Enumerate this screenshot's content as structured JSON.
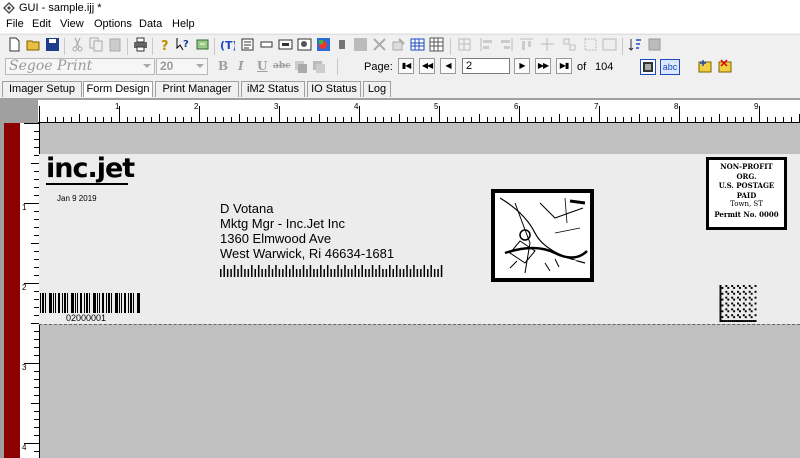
{
  "window": {
    "title": "GUI - sample.ijj *"
  },
  "menu": [
    "File",
    "Edit",
    "View",
    "Options",
    "Data",
    "Help"
  ],
  "format_bar": {
    "font_name": "Segoe Print",
    "font_size": "20",
    "bold_label": "B",
    "italic_label": "I",
    "underline_label": "U",
    "strike_label": "abc"
  },
  "pager": {
    "label": "Page:",
    "current": "2",
    "of_label": "of",
    "total": "104",
    "text_toggle_label": "abc"
  },
  "tabs": [
    {
      "label": "Imager Setup",
      "active": false
    },
    {
      "label": "Form Design",
      "active": true
    },
    {
      "label": "Print Manager",
      "active": false
    },
    {
      "label": "iM2 Status",
      "active": false
    },
    {
      "label": "IO Status",
      "active": false
    },
    {
      "label": "Log",
      "active": false
    }
  ],
  "ruler": {
    "horizontal": [
      "1",
      "2",
      "3",
      "4",
      "5",
      "6",
      "7",
      "8",
      "9"
    ],
    "vertical": [
      "1",
      "2",
      "3",
      "4"
    ]
  },
  "label": {
    "logo": "inc.jet",
    "date": "Jan 9 2019",
    "address": [
      "D Votana",
      "Mktg Mgr - Inc.Jet Inc",
      "1360 Elmwood Ave",
      "West Warwick, Ri 46634-1681"
    ],
    "stamp": [
      "NON-PROFIT",
      "ORG.",
      "U.S. POSTAGE",
      "PAID",
      "Town, ST",
      "Permit No. 0000"
    ],
    "barcode_number": "02000001"
  },
  "colors": {
    "accent_bar": "#8b0000",
    "workspace": "#a0a0a0",
    "label_bg": "#ececec"
  }
}
